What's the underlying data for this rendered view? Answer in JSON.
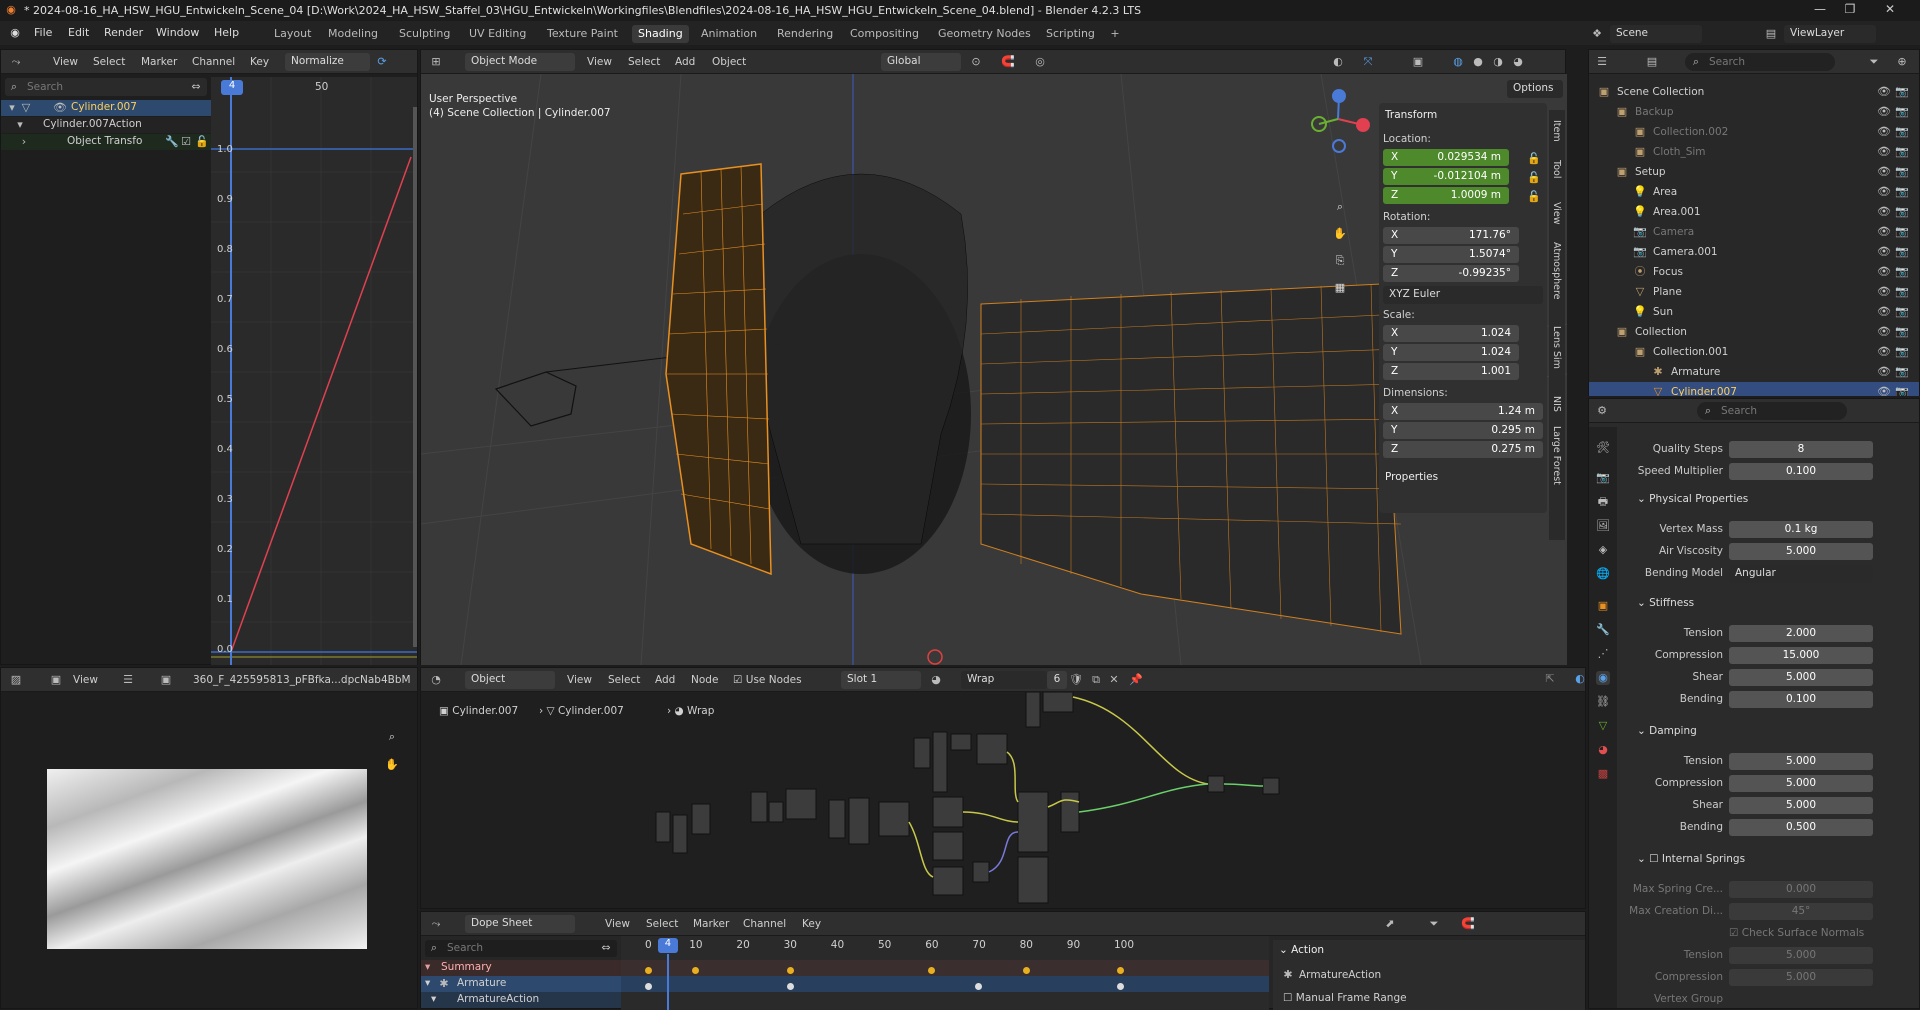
{
  "title": "* 2024-08-16_HA_HSW_HGU_Entwickeln_Scene_04 [D:\\Work\\2024_HA_HSW_Staffel_03\\HGU_Entwickeln\\Workingfiles\\Blendfiles\\2024-08-16_HA_HSW_HGU_Entwickeln_Scene_04.blend] - Blender 4.2.3 LTS",
  "menu": [
    "File",
    "Edit",
    "Render",
    "Window",
    "Help"
  ],
  "workspaces": [
    "Layout",
    "Modeling",
    "Sculpting",
    "UV Editing",
    "Texture Paint",
    "Shading",
    "Animation",
    "Rendering",
    "Compositing",
    "Geometry Nodes",
    "Scripting"
  ],
  "scene": {
    "scene_name": "Scene",
    "view_layer": "ViewLayer"
  },
  "graph": {
    "menus": [
      "View",
      "Select",
      "Marker",
      "Channel",
      "Key"
    ],
    "normalize": "Normalize",
    "search_placeholder": "Search",
    "frame_current": "4",
    "frame_50": "50",
    "channels": [
      "Cylinder.007",
      "Cylinder.007Action",
      "Object Transfo"
    ],
    "yticks": [
      "1.0",
      "0.9",
      "0.8",
      "0.7",
      "0.6",
      "0.5",
      "0.4",
      "0.3",
      "0.2",
      "0.1",
      "0.0"
    ]
  },
  "viewport": {
    "mode": "Object Mode",
    "menus": [
      "View",
      "Select",
      "Add",
      "Object"
    ],
    "orientation": "Global",
    "options": "Options",
    "perspective": "User Perspective",
    "collection_line": "(4) Scene Collection | Cylinder.007",
    "tabs": [
      "Item",
      "Tool",
      "View",
      "Atmosphere",
      "Lens Sim",
      "NIS",
      "Large Forest"
    ],
    "transform": {
      "title": "Transform",
      "location_label": "Location:",
      "location": [
        {
          "axis": "X",
          "value": "0.029534 m"
        },
        {
          "axis": "Y",
          "value": "-0.012104 m"
        },
        {
          "axis": "Z",
          "value": "1.0009 m"
        }
      ],
      "rotation_label": "Rotation:",
      "rotation": [
        {
          "axis": "X",
          "value": "171.76°"
        },
        {
          "axis": "Y",
          "value": "1.5074°"
        },
        {
          "axis": "Z",
          "value": "-0.99235°"
        }
      ],
      "rotation_mode": "XYZ Euler",
      "scale_label": "Scale:",
      "scale": [
        {
          "axis": "X",
          "value": "1.024"
        },
        {
          "axis": "Y",
          "value": "1.024"
        },
        {
          "axis": "Z",
          "value": "1.001"
        }
      ],
      "dimensions_label": "Dimensions:",
      "dimensions": [
        {
          "axis": "X",
          "value": "1.24 m"
        },
        {
          "axis": "Y",
          "value": "0.295 m"
        },
        {
          "axis": "Z",
          "value": "0.275 m"
        }
      ],
      "properties": "Properties"
    }
  },
  "outliner": {
    "search_placeholder": "Search",
    "items": [
      {
        "label": "Scene Collection",
        "indent": 0
      },
      {
        "label": "Backup",
        "indent": 1,
        "dim": true
      },
      {
        "label": "Collection.002",
        "indent": 2,
        "dim": true
      },
      {
        "label": "Cloth_Sim",
        "indent": 2,
        "dim": true
      },
      {
        "label": "Setup",
        "indent": 1
      },
      {
        "label": "Area",
        "indent": 2
      },
      {
        "label": "Area.001",
        "indent": 2
      },
      {
        "label": "Camera",
        "indent": 2,
        "dim": true
      },
      {
        "label": "Camera.001",
        "indent": 2
      },
      {
        "label": "Focus",
        "indent": 2
      },
      {
        "label": "Plane",
        "indent": 2
      },
      {
        "label": "Sun",
        "indent": 2
      },
      {
        "label": "Collection",
        "indent": 1
      },
      {
        "label": "Collection.001",
        "indent": 2
      },
      {
        "label": "Armature",
        "indent": 3
      },
      {
        "label": "Cylinder.007",
        "indent": 3,
        "selected": true
      }
    ]
  },
  "properties": {
    "search_placeholder": "Search",
    "rows": [
      {
        "label": "Quality Steps",
        "value": "8",
        "y": 0
      },
      {
        "label": "Speed Multiplier",
        "value": "0.100",
        "y": 18
      }
    ],
    "physical": "Physical Properties",
    "vertex_mass": {
      "label": "Vertex Mass",
      "value": "0.1 kg"
    },
    "air_viscosity": {
      "label": "Air Viscosity",
      "value": "5.000"
    },
    "bending_model": {
      "label": "Bending Model",
      "value": "Angular"
    },
    "stiffness": "Stiffness",
    "stiff_rows": [
      {
        "label": "Tension",
        "value": "2.000"
      },
      {
        "label": "Compression",
        "value": "15.000"
      },
      {
        "label": "Shear",
        "value": "5.000"
      },
      {
        "label": "Bending",
        "value": "0.100"
      }
    ],
    "damping": "Damping",
    "damp_rows": [
      {
        "label": "Tension",
        "value": "5.000"
      },
      {
        "label": "Compression",
        "value": "5.000"
      },
      {
        "label": "Shear",
        "value": "5.000"
      },
      {
        "label": "Bending",
        "value": "0.500"
      }
    ],
    "internal": "Internal Springs",
    "internal_rows": [
      {
        "label": "Max Spring Cre...",
        "value": "0.000"
      },
      {
        "label": "Max Creation Di...",
        "value": "45°"
      }
    ],
    "check_surface": "Check Surface Normals",
    "internal_rows2": [
      {
        "label": "Tension",
        "value": "5.000"
      },
      {
        "label": "Compression",
        "value": "5.000"
      },
      {
        "label": "Vertex Group",
        "value": ""
      }
    ]
  },
  "image_editor": {
    "view": "View",
    "image_name": "360_F_425595813_pFBfka...dpcNab4BbM"
  },
  "node_editor": {
    "type": "Object",
    "menus": [
      "View",
      "Select",
      "Add",
      "Node"
    ],
    "use_nodes": "Use Nodes",
    "slot": "Slot 1",
    "material": "Wrap",
    "users": "6",
    "breadcrumb": [
      "Cylinder.007",
      "Cylinder.007",
      "Wrap"
    ]
  },
  "dopesheet": {
    "mode": "Dope Sheet",
    "menus": [
      "View",
      "Select",
      "Marker",
      "Channel",
      "Key"
    ],
    "search_placeholder": "Search",
    "current_frame": "4",
    "ticks": [
      "0",
      "10",
      "20",
      "30",
      "40",
      "50",
      "60",
      "70",
      "80",
      "90",
      "100"
    ],
    "channels": [
      "Summary",
      "Armature",
      "ArmatureAction"
    ],
    "action_title": "Action",
    "action_name": "ArmatureAction",
    "manual_range": "Manual Frame Range"
  }
}
